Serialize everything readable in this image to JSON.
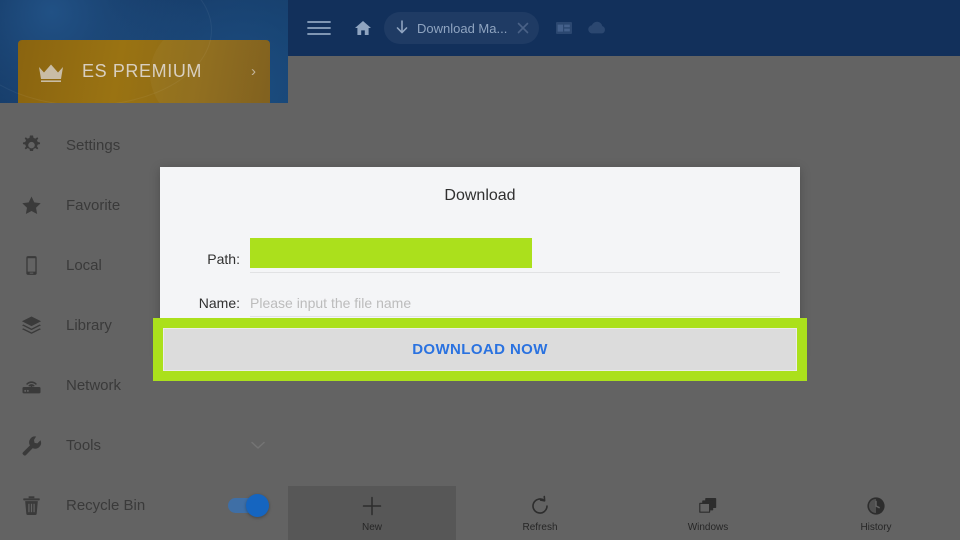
{
  "topbar": {
    "background_color": "#12305b",
    "menu_icon": "hamburger-menu-icon",
    "home_icon": "home-icon",
    "tab": {
      "icon": "download-arrow-icon",
      "label": "Download Ma...",
      "close_icon": "close-icon"
    },
    "windows_icon": "windows-icon",
    "cloud_icon": "cloud-icon"
  },
  "sidebar": {
    "premium": {
      "icon": "crown-icon",
      "label": "ES PREMIUM",
      "chevron": "›",
      "background_color": "#8a6410"
    },
    "items": [
      {
        "label": "Settings",
        "icon": "gear-icon"
      },
      {
        "label": "Favorite",
        "icon": "star-icon"
      },
      {
        "label": "Local",
        "icon": "phone-icon"
      },
      {
        "label": "Library",
        "icon": "layers-icon"
      },
      {
        "label": "Network",
        "icon": "router-wifi-icon"
      },
      {
        "label": "Tools",
        "icon": "wrench-icon",
        "chevron": "⌄"
      },
      {
        "label": "Recycle Bin",
        "icon": "trash-icon",
        "toggle_on": true
      }
    ]
  },
  "dialog": {
    "title": "Download",
    "path": {
      "label": "Path:",
      "value": "",
      "placeholder": ""
    },
    "name": {
      "label": "Name:",
      "value": "",
      "placeholder": "Please input the file name"
    },
    "primary_button": {
      "label": "DOWNLOAD NOW",
      "text_color": "#2a72e0",
      "background_color": "#dcdcdc"
    }
  },
  "highlight": {
    "color": "#abe01c",
    "targets": [
      "path-field",
      "download-now-button"
    ]
  },
  "bottombar": {
    "items": [
      {
        "label": "New",
        "icon": "plus-icon",
        "pressed": true
      },
      {
        "label": "Refresh",
        "icon": "refresh-icon",
        "pressed": false
      },
      {
        "label": "Windows",
        "icon": "windows-stack-icon",
        "pressed": false
      },
      {
        "label": "History",
        "icon": "clock-icon",
        "pressed": false
      }
    ]
  },
  "scrim": {
    "color": "#636363"
  }
}
